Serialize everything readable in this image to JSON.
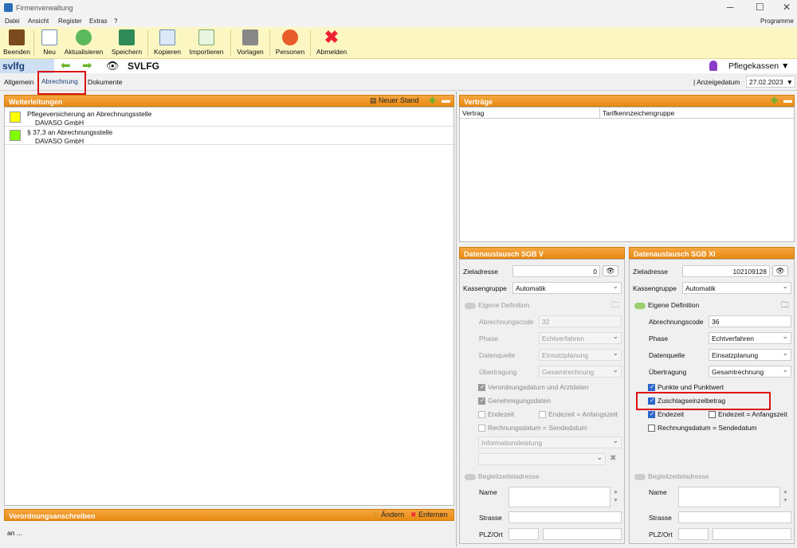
{
  "window": {
    "title": "Firmenverwaltung",
    "minimize": "─",
    "maximize": "☐",
    "close": "✕"
  },
  "menu": {
    "items": [
      "Datei",
      "Ansicht",
      "Register",
      "Extras",
      "?"
    ],
    "right": "Programme"
  },
  "toolbar": {
    "beenden": "Beenden",
    "neu": "Neu",
    "aktualisieren": "Aktualisieren",
    "speichern": "Speichern",
    "kopieren": "Kopieren",
    "importieren": "Importieren",
    "vorlagen": "Vorlagen",
    "personen": "Personen",
    "abmelden": "Abmelden"
  },
  "nav": {
    "code": "svlfg",
    "name": "SVLFG",
    "group": "Pflegekassen"
  },
  "tabs": {
    "allgemein": "Allgemein",
    "abrechnung": "Abrechnung",
    "dokumente": "Dokumente"
  },
  "anzeigedatum": {
    "label": "Anzeigedatum",
    "value": "27.02.2023"
  },
  "weiterleitungen": {
    "title": "Weiterleitungen",
    "neuer_stand": "Neuer Stand",
    "items": [
      {
        "line1": "Pflegeversicherung an Abrechnungsstelle",
        "line2": "DAVASO GmbH",
        "color": "#ffff00"
      },
      {
        "line1": "§ 37,3 an Abrechnungsstelle",
        "line2": "DAVASO GmbH",
        "color": "#80ff00"
      }
    ]
  },
  "vertraege": {
    "title": "Verträge",
    "col1": "Vertrag",
    "col2": "Tarifkennzeichengruppe"
  },
  "verordnung": {
    "title": "Verordnungsanschreiben",
    "aendern": "Ändern",
    "entfernen": "Enfernen",
    "text": "an ..."
  },
  "sgb5": {
    "title": "Datenaustausch SGB V",
    "zieladresse_label": "Zieladresse",
    "zieladresse": "0",
    "kassengruppe_label": "Kassengruppe",
    "kassengruppe": "Automatik",
    "eigene": "Eigene Definition",
    "abrechnungscode_label": "Abrechnungscode",
    "abrechnungscode": "32",
    "phase_label": "Phase",
    "phase": "Echtverfahren",
    "datenquelle_label": "Datenquelle",
    "datenquelle": "Einsatzplanung",
    "uebertragung_label": "Übertragung",
    "uebertragung": "Gesamtrechnung",
    "verordnungsdatum": "Verordnungsdatum und Arztdaten",
    "genehmigung": "Genehmigungsdaten",
    "endezeit": "Endezeit",
    "endezeit_anfang": "Endezeit = Anfangszeit",
    "rechnungsdatum": "Rechnungsdatum = Sendedatum",
    "infoleistung": "Informationsleistung",
    "begleit": "Begleitzetteladresse",
    "name": "Name",
    "strasse": "Strasse",
    "plz": "PLZ/Ort"
  },
  "sgb11": {
    "title": "Datenaustausch SGB XI",
    "zieladresse_label": "Zieladresse",
    "zieladresse": "102109128",
    "kassengruppe_label": "Kassengruppe",
    "kassengruppe": "Automatik",
    "eigene": "Eigene Definition",
    "abrechnungscode_label": "Abrechnungscode",
    "abrechnungscode": "36",
    "phase_label": "Phase",
    "phase": "Echtverfahren",
    "datenquelle_label": "Datenquelle",
    "datenquelle": "Einsatzplanung",
    "uebertragung_label": "Übertragung",
    "uebertragung": "Gesamtrechnung",
    "punkte": "Punkte und Punktwert",
    "zuschlag": "Zuschlagseinzelbetrag",
    "endezeit": "Endezeit",
    "endezeit_anfang": "Endezeit = Anfangszeit",
    "rechnungsdatum": "Rechnungsdatum = Sendedatum",
    "begleit": "Begleitzetteladresse",
    "name": "Name",
    "strasse": "Strasse",
    "plz": "PLZ/Ort"
  }
}
